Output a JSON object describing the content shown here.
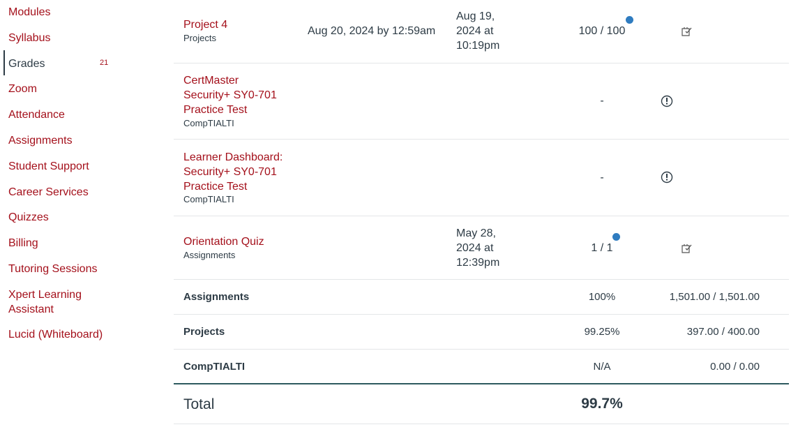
{
  "nav": {
    "items": [
      {
        "label": "Modules"
      },
      {
        "label": "Syllabus"
      },
      {
        "label": "Grades",
        "badge": "21"
      },
      {
        "label": "Zoom"
      },
      {
        "label": "Attendance"
      },
      {
        "label": "Assignments"
      },
      {
        "label": "Student Support"
      },
      {
        "label": "Career Services"
      },
      {
        "label": "Quizzes"
      },
      {
        "label": "Billing"
      },
      {
        "label": "Tutoring Sessions"
      },
      {
        "label": "Xpert Learning Assistant"
      },
      {
        "label": "Lucid (Whiteboard)"
      }
    ]
  },
  "grades": {
    "rows": [
      {
        "title": "Project 4",
        "context": "Projects",
        "due": "Aug 20, 2024 by 12:59am",
        "submitted": "Aug 19, 2024 at 10:19pm",
        "score": "100 / 100",
        "icon": "rubric-icon"
      },
      {
        "title": "CertMaster Security+ SY0-701 Practice Test",
        "context": "CompTIALTI",
        "due": "",
        "submitted": "",
        "score": "-",
        "icon": "warning-icon"
      },
      {
        "title": "Learner Dashboard: Security+ SY0-701 Practice Test",
        "context": "CompTIALTI",
        "due": "",
        "submitted": "",
        "score": "-",
        "icon": "warning-icon"
      },
      {
        "title": "Orientation Quiz",
        "context": "Assignments",
        "due": "",
        "submitted": "May 28, 2024 at 12:39pm",
        "score": "1 / 1",
        "icon": "rubric-icon"
      }
    ],
    "summary": [
      {
        "label": "Assignments",
        "percent": "100%",
        "points": "1,501.00 / 1,501.00"
      },
      {
        "label": "Projects",
        "percent": "99.25%",
        "points": "397.00 / 400.00"
      },
      {
        "label": "CompTIALTI",
        "percent": "N/A",
        "points": "0.00 / 0.00"
      }
    ],
    "total_label": "Total",
    "total_value": "99.7%"
  },
  "colors": {
    "link": "#a4101b",
    "text": "#2d3b45",
    "unread_dot": "#2f7cc0"
  }
}
